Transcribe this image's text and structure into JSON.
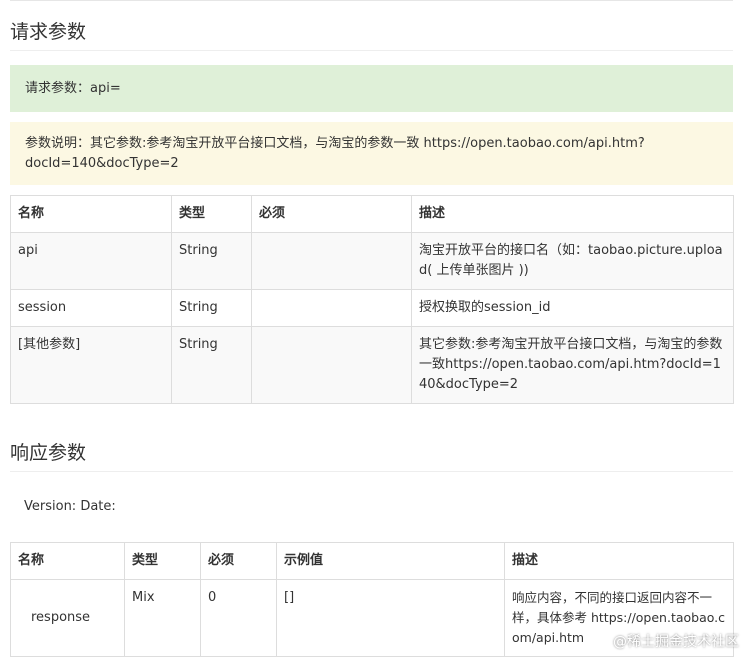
{
  "request": {
    "heading": "请求参数",
    "success_box": "请求参数：api=",
    "warning_box_line1": "参数说明：其它参数:参考淘宝开放平台接口文档，与淘宝的参数一致 https://open.taobao.com/api.htm?",
    "warning_box_line2": "docId=140&docType=2",
    "table": {
      "headers": [
        "名称",
        "类型",
        "必须",
        "描述"
      ],
      "rows": [
        {
          "name": "api",
          "type": "String",
          "required": "",
          "desc": "淘宝开放平台的接口名（如：taobao.picture.upload( 上传单张图片 ))"
        },
        {
          "name": "session",
          "type": "String",
          "required": "",
          "desc": "授权换取的session_id"
        },
        {
          "name": "[其他参数]",
          "type": "String",
          "required": "",
          "desc": "其它参数:参考淘宝开放平台接口文档，与淘宝的参数一致https://open.taobao.com/api.htm?docId=140&docType=2"
        }
      ]
    }
  },
  "response": {
    "heading": "响应参数",
    "version_line": "Version: Date:",
    "table": {
      "headers": [
        "名称",
        "类型",
        "必须",
        "示例值",
        "描述"
      ],
      "rows": [
        {
          "name": "response",
          "type": "Mix",
          "required": "0",
          "example": "[]",
          "desc": "响应内容，不同的接口返回内容不一样，具体参考 https://open.taobao.com/api.htm"
        }
      ]
    }
  },
  "watermark": "@稀土掘金技术社区"
}
